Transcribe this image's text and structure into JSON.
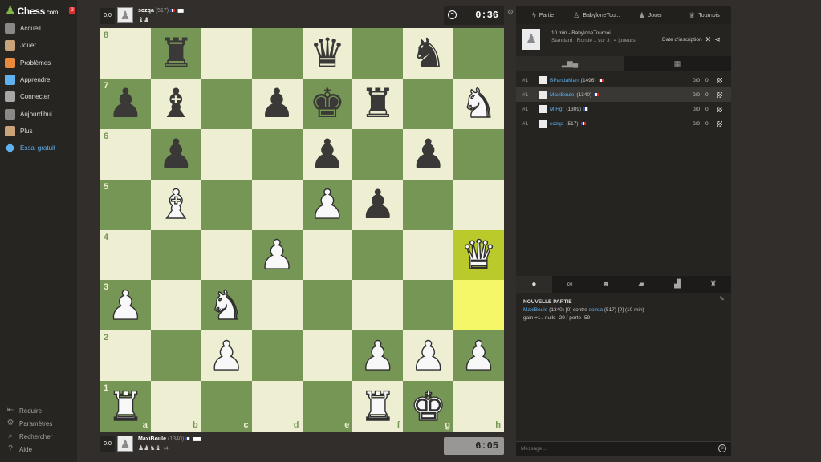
{
  "app": {
    "logo_text": "Chess",
    "logo_suffix": ".com",
    "notification_count": "2"
  },
  "sidebar": {
    "items": [
      {
        "label": "Accueil",
        "icon": "home-icon",
        "color": "#8b8987"
      },
      {
        "label": "Jouer",
        "icon": "play-icon",
        "color": "#c9a47a"
      },
      {
        "label": "Problèmes",
        "icon": "puzzle-icon",
        "color": "#e88a3a"
      },
      {
        "label": "Apprendre",
        "icon": "learn-icon",
        "color": "#5fb1ef"
      },
      {
        "label": "Connecter",
        "icon": "connect-icon",
        "color": "#a9a7a5"
      },
      {
        "label": "Aujourd'hui",
        "icon": "today-icon",
        "color": "#8b8987"
      },
      {
        "label": "Plus",
        "icon": "more-icon",
        "color": "#c9a47a"
      },
      {
        "label": "Essai gratuit",
        "icon": "diamond-icon",
        "color": "#5fb1ef"
      }
    ],
    "footer": [
      {
        "label": "Réduire",
        "icon": "collapse-icon"
      },
      {
        "label": "Paramètres",
        "icon": "gear-icon"
      },
      {
        "label": "Rechercher",
        "icon": "search-icon"
      },
      {
        "label": "Aide",
        "icon": "help-icon"
      }
    ]
  },
  "top_player": {
    "score": "0.0",
    "name": "sozqa",
    "rating": "(517)",
    "captured": "♝♟",
    "clock": "0:36",
    "clock_active": true
  },
  "bottom_player": {
    "score": "0.0",
    "name": "MaxiBoule",
    "rating": "(1340)",
    "captured": "♟♟♞♝",
    "advantage": "+4",
    "clock": "6:05",
    "clock_active": false
  },
  "board": {
    "files": [
      "a",
      "b",
      "c",
      "d",
      "e",
      "f",
      "g",
      "h"
    ],
    "ranks": [
      "8",
      "7",
      "6",
      "5",
      "4",
      "3",
      "2",
      "1"
    ],
    "highlighted": [
      "h4",
      "h3"
    ],
    "position": [
      [
        "",
        "r",
        "",
        "",
        "q",
        "",
        "n",
        ""
      ],
      [
        "p",
        "b",
        "",
        "p",
        "k",
        "r",
        "",
        "N"
      ],
      [
        "",
        "p",
        "",
        "",
        "p",
        "",
        "p",
        ""
      ],
      [
        "",
        "B",
        "",
        "",
        "P",
        "p",
        "",
        ""
      ],
      [
        "",
        "",
        "",
        "P",
        "",
        "",
        "",
        "Q"
      ],
      [
        "P",
        "",
        "N",
        "",
        "",
        "",
        "",
        ""
      ],
      [
        "",
        "",
        "P",
        "",
        "",
        "P",
        "P",
        "P"
      ],
      [
        "R",
        "",
        "",
        "",
        "",
        "R",
        "K",
        ""
      ]
    ]
  },
  "panel": {
    "tabs": [
      {
        "label": "Partie",
        "icon": "lightning-icon"
      },
      {
        "label": "BabyloneTou...",
        "icon": "tournament-icon"
      },
      {
        "label": "Jouer",
        "icon": "pawn-icon"
      },
      {
        "label": "Tournois",
        "icon": "trophy-icon"
      }
    ],
    "tournament": {
      "title": "10 min - BabyloneTournoi",
      "subtitle": "Standard : Ronde 1 sur 3 | 4 joueurs",
      "join_label": "Date d'inscription"
    },
    "standings": [
      {
        "rank": "#1",
        "name": "BPandaMan",
        "rating": "(1496)",
        "result": "0/0",
        "points": "0"
      },
      {
        "rank": "#1",
        "name": "MaxiBoule",
        "rating": "(1340)",
        "result": "0/0",
        "points": "0"
      },
      {
        "rank": "#1",
        "name": "M Hgt",
        "rating": "(1309)",
        "result": "0/0",
        "points": "0"
      },
      {
        "rank": "#1",
        "name": "sozqa",
        "rating": "(517)",
        "result": "0/0",
        "points": "0"
      }
    ],
    "chat": {
      "title": "NOUVELLE PARTIE",
      "white_name": "MaxiBoule",
      "white_rating": "(1340) [0]",
      "versus": "contre",
      "black_name": "sozqa",
      "black_rating": "(517) [0] (10 min)",
      "outcomes": "gain +1 / nulle -29 / perte -59",
      "input_placeholder": "Message..."
    }
  },
  "colors": {
    "light_square": "#eeeed2",
    "dark_square": "#769656",
    "link": "#5fb1ef",
    "accent": "#81b64c"
  }
}
